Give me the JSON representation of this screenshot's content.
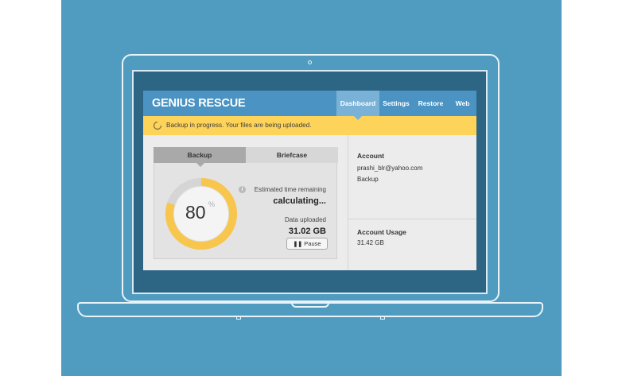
{
  "app": {
    "logo": "GENIUS RESCUE",
    "nav": [
      {
        "label": "Dashboard",
        "active": true
      },
      {
        "label": "Settings",
        "active": false
      },
      {
        "label": "Restore",
        "active": false
      },
      {
        "label": "Web",
        "active": false
      }
    ]
  },
  "banner": {
    "icon": "progress-spinner-icon",
    "text": "Backup in progress. Your files are being uploaded."
  },
  "panel": {
    "tabs": [
      {
        "label": "Backup",
        "active": true
      },
      {
        "label": "Briefcase",
        "active": false
      }
    ],
    "progress": {
      "value": 80,
      "display": "80",
      "unit": "%"
    },
    "estimate_label": "Estimated time remaining",
    "estimate_value": "calculating...",
    "uploaded_label": "Data uploaded",
    "uploaded_value": "31.02 GB",
    "pause_label": "Pause",
    "pause_icon": "pause-icon"
  },
  "sidebar": {
    "account_heading": "Account",
    "email": "prashi_blr@yahoo.com",
    "plan": "Backup",
    "usage_heading": "Account Usage",
    "usage_value": "31.42 GB"
  },
  "colors": {
    "background": "#4f9cc0",
    "header": "#4a93c2",
    "active_tab": "#7ab1d6",
    "banner": "#fed35a",
    "progress_ring": "#f8c54d",
    "ring_track": "#d5d5d5"
  }
}
